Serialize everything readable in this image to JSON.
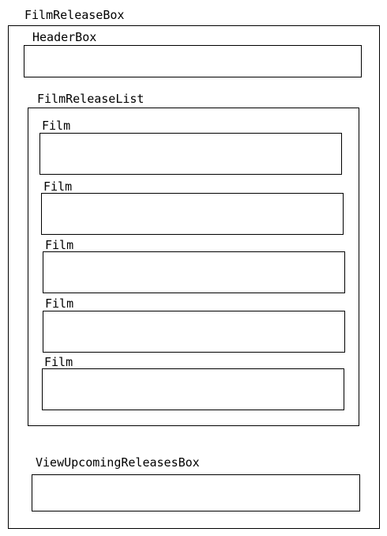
{
  "diagram": {
    "outer": {
      "label": "FilmReleaseBox"
    },
    "header": {
      "label": "HeaderBox"
    },
    "list": {
      "label": "FilmReleaseList",
      "items": [
        {
          "label": "Film"
        },
        {
          "label": "Film"
        },
        {
          "label": "Film"
        },
        {
          "label": "Film"
        },
        {
          "label": "Film"
        }
      ]
    },
    "upcoming": {
      "label": "ViewUpcomingReleasesBox"
    }
  },
  "colors": {
    "line": "#000000",
    "background": "#ffffff"
  }
}
